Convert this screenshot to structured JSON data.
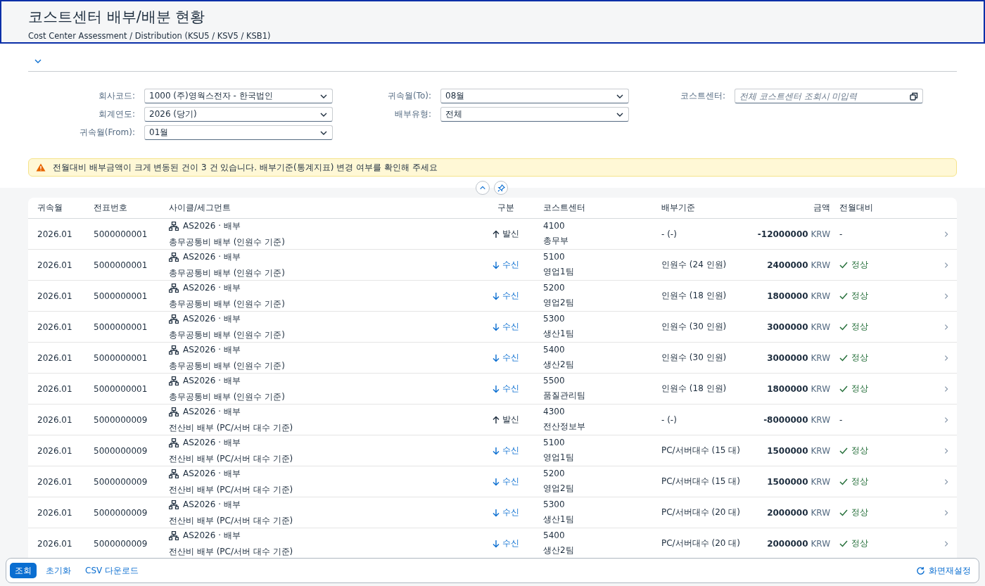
{
  "header": {
    "title": "코스트센터 배부/배분 현황",
    "subtitle": "Cost Center Assessment / Distribution (KSU5 / KSV5 / KSB1)"
  },
  "filter_bar": {
    "expanded": true,
    "columns": [
      [
        {
          "label": "회사코드:",
          "kind": "select",
          "value": "1000 (주)영웍스전자 - 한국법인"
        },
        {
          "label": "회계연도:",
          "kind": "select",
          "value": "2026 (당기)"
        },
        {
          "label": "귀속월(From):",
          "kind": "select",
          "value": "01월"
        }
      ],
      [
        {
          "label": "귀속월(To):",
          "kind": "select",
          "value": "08월"
        },
        {
          "label": "배부유형:",
          "kind": "select",
          "value": "전체"
        }
      ],
      [
        {
          "label": "코스트센터:",
          "kind": "valuehelp",
          "placeholder": "전체 코스트센터 조회시 미입력"
        }
      ]
    ]
  },
  "message": {
    "kind": "warning",
    "text": "전월대비 배부금액이 크게 변동된 건이 3 건 있습니다. 배부기준(통계지표) 변경 여부를 확인해 주세요"
  },
  "table": {
    "columns": [
      "귀속월",
      "전표번호",
      "사이클/세그먼트",
      "구분",
      "코스트센터",
      "배부기준",
      "금액",
      "전월대비"
    ],
    "rows": [
      {
        "period": "2026.01",
        "doc": "5000000001",
        "cycle": "AS2026 · 배부",
        "segment": "총무공통비 배부 (인원수 기준)",
        "direction": {
          "kind": "send",
          "label": "발신"
        },
        "cc_code": "4100",
        "cc_name": "총무부",
        "basis": "- (-)",
        "amount": "-12000000",
        "currency": "KRW",
        "status": {
          "kind": "none",
          "label": "-"
        }
      },
      {
        "period": "2026.01",
        "doc": "5000000001",
        "cycle": "AS2026 · 배부",
        "segment": "총무공통비 배부 (인원수 기준)",
        "direction": {
          "kind": "receive",
          "label": "수신"
        },
        "cc_code": "5100",
        "cc_name": "영업1팀",
        "basis": "인원수 (24 인원)",
        "amount": "2400000",
        "currency": "KRW",
        "status": {
          "kind": "ok",
          "label": "정상"
        }
      },
      {
        "period": "2026.01",
        "doc": "5000000001",
        "cycle": "AS2026 · 배부",
        "segment": "총무공통비 배부 (인원수 기준)",
        "direction": {
          "kind": "receive",
          "label": "수신"
        },
        "cc_code": "5200",
        "cc_name": "영업2팀",
        "basis": "인원수 (18 인원)",
        "amount": "1800000",
        "currency": "KRW",
        "status": {
          "kind": "ok",
          "label": "정상"
        }
      },
      {
        "period": "2026.01",
        "doc": "5000000001",
        "cycle": "AS2026 · 배부",
        "segment": "총무공통비 배부 (인원수 기준)",
        "direction": {
          "kind": "receive",
          "label": "수신"
        },
        "cc_code": "5300",
        "cc_name": "생산1팀",
        "basis": "인원수 (30 인원)",
        "amount": "3000000",
        "currency": "KRW",
        "status": {
          "kind": "ok",
          "label": "정상"
        }
      },
      {
        "period": "2026.01",
        "doc": "5000000001",
        "cycle": "AS2026 · 배부",
        "segment": "총무공통비 배부 (인원수 기준)",
        "direction": {
          "kind": "receive",
          "label": "수신"
        },
        "cc_code": "5400",
        "cc_name": "생산2팀",
        "basis": "인원수 (30 인원)",
        "amount": "3000000",
        "currency": "KRW",
        "status": {
          "kind": "ok",
          "label": "정상"
        }
      },
      {
        "period": "2026.01",
        "doc": "5000000001",
        "cycle": "AS2026 · 배부",
        "segment": "총무공통비 배부 (인원수 기준)",
        "direction": {
          "kind": "receive",
          "label": "수신"
        },
        "cc_code": "5500",
        "cc_name": "품질관리팀",
        "basis": "인원수 (18 인원)",
        "amount": "1800000",
        "currency": "KRW",
        "status": {
          "kind": "ok",
          "label": "정상"
        }
      },
      {
        "period": "2026.01",
        "doc": "5000000009",
        "cycle": "AS2026 · 배부",
        "segment": "전산비 배부 (PC/서버 대수 기준)",
        "direction": {
          "kind": "send",
          "label": "발신"
        },
        "cc_code": "4300",
        "cc_name": "전산정보부",
        "basis": "- (-)",
        "amount": "-8000000",
        "currency": "KRW",
        "status": {
          "kind": "none",
          "label": "-"
        }
      },
      {
        "period": "2026.01",
        "doc": "5000000009",
        "cycle": "AS2026 · 배부",
        "segment": "전산비 배부 (PC/서버 대수 기준)",
        "direction": {
          "kind": "receive",
          "label": "수신"
        },
        "cc_code": "5100",
        "cc_name": "영업1팀",
        "basis": "PC/서버대수 (15 대)",
        "amount": "1500000",
        "currency": "KRW",
        "status": {
          "kind": "ok",
          "label": "정상"
        }
      },
      {
        "period": "2026.01",
        "doc": "5000000009",
        "cycle": "AS2026 · 배부",
        "segment": "전산비 배부 (PC/서버 대수 기준)",
        "direction": {
          "kind": "receive",
          "label": "수신"
        },
        "cc_code": "5200",
        "cc_name": "영업2팀",
        "basis": "PC/서버대수 (15 대)",
        "amount": "1500000",
        "currency": "KRW",
        "status": {
          "kind": "ok",
          "label": "정상"
        }
      },
      {
        "period": "2026.01",
        "doc": "5000000009",
        "cycle": "AS2026 · 배부",
        "segment": "전산비 배부 (PC/서버 대수 기준)",
        "direction": {
          "kind": "receive",
          "label": "수신"
        },
        "cc_code": "5300",
        "cc_name": "생산1팀",
        "basis": "PC/서버대수 (20 대)",
        "amount": "2000000",
        "currency": "KRW",
        "status": {
          "kind": "ok",
          "label": "정상"
        }
      },
      {
        "period": "2026.01",
        "doc": "5000000009",
        "cycle": "AS2026 · 배부",
        "segment": "전산비 배부 (PC/서버 대수 기준)",
        "direction": {
          "kind": "receive",
          "label": "수신"
        },
        "cc_code": "5400",
        "cc_name": "생산2팀",
        "basis": "PC/서버대수 (20 대)",
        "amount": "2000000",
        "currency": "KRW",
        "status": {
          "kind": "ok",
          "label": "정상"
        }
      }
    ]
  },
  "footer": {
    "buttons": [
      {
        "label": "조회",
        "selected": true
      },
      {
        "label": "초기화",
        "selected": false
      },
      {
        "label": "CSV 다운로드",
        "selected": false
      }
    ],
    "reset": "화면재설정"
  }
}
